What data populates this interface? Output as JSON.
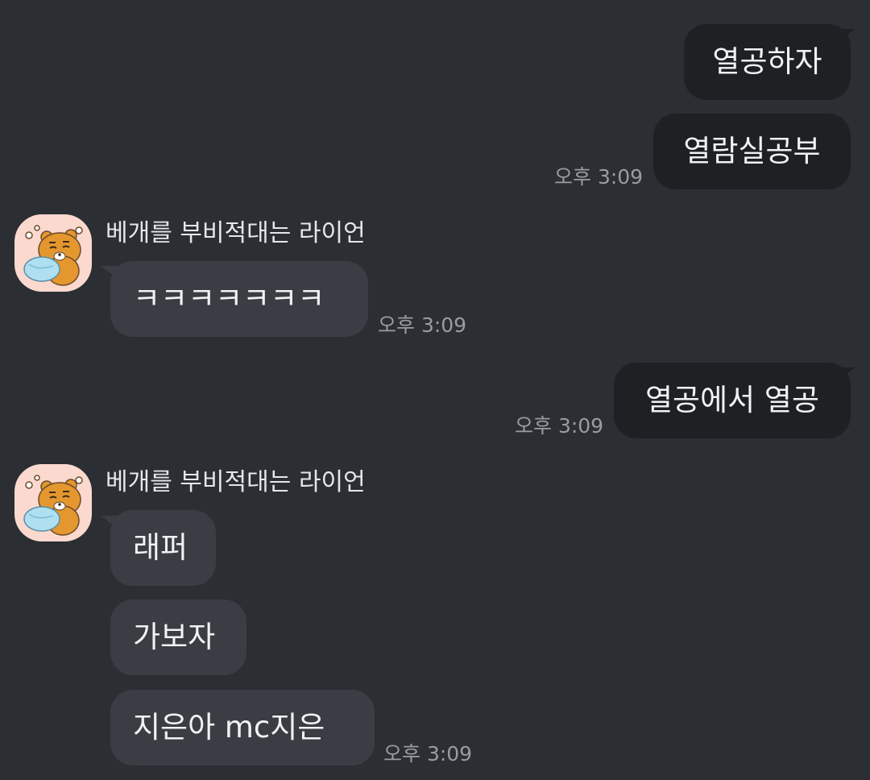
{
  "chat": {
    "sender_name": "베개를 부비적대는 라이언",
    "timestamp": "오후 3:09",
    "messages": [
      {
        "from": "me",
        "text": "열공하자"
      },
      {
        "from": "me",
        "text": "열람실공부",
        "time": "오후 3:09"
      },
      {
        "from": "other",
        "text": "ㅋㅋㅋㅋㅋㅋㅋ",
        "time": "오후 3:09"
      },
      {
        "from": "me",
        "text": "열공에서 열공",
        "time": "오후 3:09"
      },
      {
        "from": "other",
        "text": "래퍼"
      },
      {
        "from": "other",
        "text": "가보자"
      },
      {
        "from": "other",
        "text": "지은아 mc지은",
        "time": "오후 3:09"
      }
    ]
  },
  "avatar": {
    "icon": "ryan-hugging-pillow-icon",
    "background_color": "#fbd9cf"
  },
  "colors": {
    "background": "#2b2e33",
    "my_bubble": "#1f2023",
    "other_bubble": "#3a3d43",
    "text": "#f1f2f3",
    "time_text": "#9a9ca1"
  }
}
